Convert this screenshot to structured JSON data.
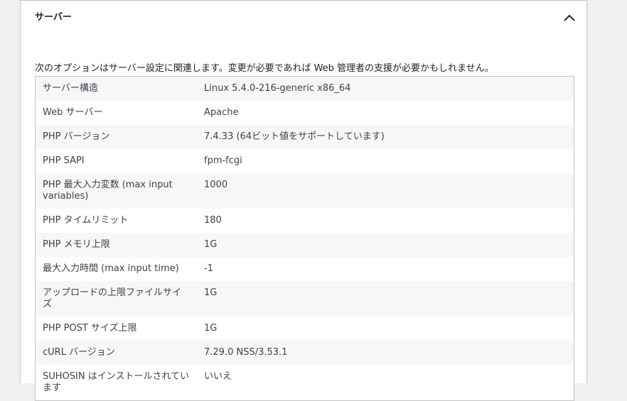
{
  "section": {
    "title": "サーバー",
    "description": "次のオプションはサーバー設定に関連します。変更が必要であれば Web 管理者の支援が必要かもしれません。",
    "toggle_icon": "chevron-up-icon"
  },
  "rows": [
    {
      "label": "サーバー構造",
      "value": "Linux 5.4.0-216-generic x86_64"
    },
    {
      "label": "Web サーバー",
      "value": "Apache"
    },
    {
      "label": "PHP バージョン",
      "value": "7.4.33 (64ビット値をサポートしています)"
    },
    {
      "label": "PHP SAPI",
      "value": "fpm-fcgi"
    },
    {
      "label": "PHP 最大入力変数 (max input variables)",
      "value": "1000"
    },
    {
      "label": "PHP タイムリミット",
      "value": "180"
    },
    {
      "label": "PHP メモリ上限",
      "value": "1G"
    },
    {
      "label": "最大入力時間 (max input time)",
      "value": "-1"
    },
    {
      "label": "アップロードの上限ファイルサイズ",
      "value": "1G"
    },
    {
      "label": "PHP POST サイズ上限",
      "value": "1G"
    },
    {
      "label": "cURL バージョン",
      "value": "7.29.0 NSS/3.53.1"
    },
    {
      "label": "SUHOSIN はインストールされています",
      "value": "いいえ"
    }
  ]
}
